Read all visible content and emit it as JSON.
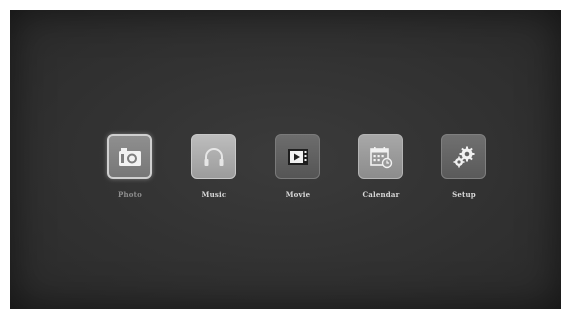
{
  "menu": {
    "items": [
      {
        "label": "Photo",
        "icon": "camera-icon",
        "selected": true
      },
      {
        "label": "Music",
        "icon": "headphones-icon",
        "selected": false
      },
      {
        "label": "Movie",
        "icon": "film-play-icon",
        "selected": false
      },
      {
        "label": "Calendar",
        "icon": "calendar-icon",
        "selected": false
      },
      {
        "label": "Setup",
        "icon": "gears-icon",
        "selected": false
      }
    ]
  }
}
